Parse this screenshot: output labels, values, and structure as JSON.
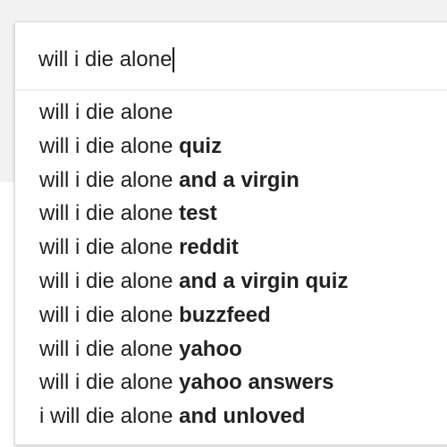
{
  "search": {
    "query": "will i die alone"
  },
  "suggestions": [
    {
      "prefix": "will i die alone",
      "completion": ""
    },
    {
      "prefix": "will i die alone ",
      "completion": "quiz"
    },
    {
      "prefix": "will i die alone ",
      "completion": "and a virgin"
    },
    {
      "prefix": "will i die alone ",
      "completion": "test"
    },
    {
      "prefix": "will i die alone ",
      "completion": "reddit"
    },
    {
      "prefix": "will i die alone ",
      "completion": "and a virgin quiz"
    },
    {
      "prefix": "will i die alone ",
      "completion": "buzzfeed"
    },
    {
      "prefix": "will i die alone ",
      "completion": "yahoo"
    },
    {
      "prefix": "will i die alone ",
      "completion": "yahoo answers"
    },
    {
      "prefix": "i will die alone ",
      "completion": "and unloved"
    }
  ],
  "colors": {
    "text": "#222222",
    "background_band": "#f2f2f2",
    "box_border": "#d9d9d9"
  }
}
